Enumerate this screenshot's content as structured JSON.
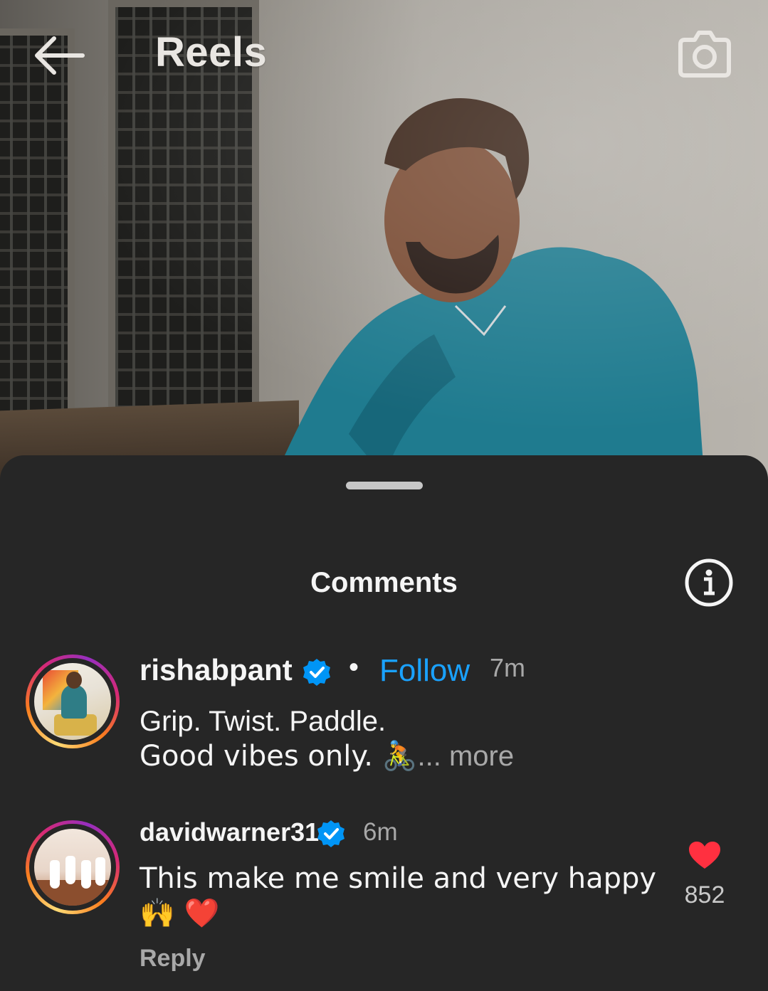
{
  "topbar": {
    "back_icon": "arrow-left-icon",
    "title": "Reels",
    "camera_icon": "camera-icon"
  },
  "sheet": {
    "title": "Comments",
    "info_icon": "info-icon"
  },
  "comments": [
    {
      "username": "rishabpant",
      "verified": true,
      "separator": "•",
      "follow_label": "Follow",
      "time": "7m",
      "line1": "Grip. Twist. Paddle.",
      "line2": "Good vibes only. 🚴",
      "more_label": "... more"
    },
    {
      "username": "davidwarner31",
      "verified": true,
      "time": "6m",
      "text": "This make me smile and very happy 🙌 ❤️",
      "reply_label": "Reply",
      "like_count": "852",
      "like_color": "#ff3040"
    }
  ],
  "colors": {
    "sheet_background": "#262626",
    "link_blue": "#1aa2ff",
    "verified_blue": "#0095f6",
    "secondary_text": "#a8a8a8"
  }
}
